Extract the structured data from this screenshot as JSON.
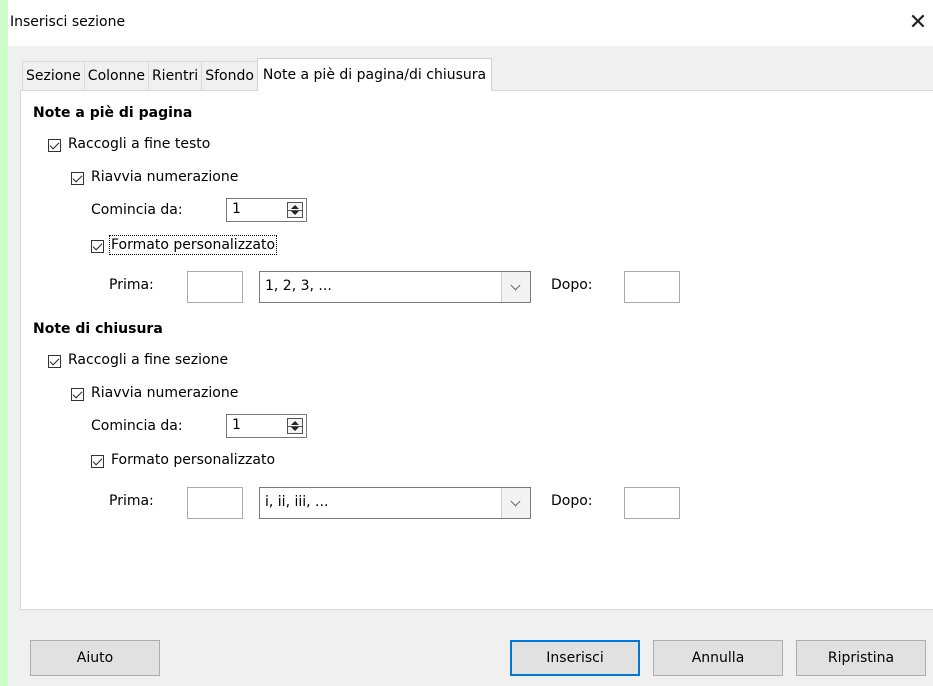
{
  "dialog": {
    "title": "Inserisci sezione",
    "close_glyph": "✕"
  },
  "tabs": [
    {
      "label": "Sezione",
      "active": false
    },
    {
      "label": "Colonne",
      "active": false
    },
    {
      "label": "Rientri",
      "active": false
    },
    {
      "label": "Sfondo",
      "active": false
    },
    {
      "label": "Note a piè di pagina/di chiusura",
      "active": true
    }
  ],
  "footnotes": {
    "heading": "Note a piè di pagina",
    "collect": {
      "label": "Raccogli a fine testo",
      "checked": true
    },
    "restart": {
      "label": "Riavvia numerazione",
      "checked": true
    },
    "start_label": "Comincia da:",
    "start_value": "1",
    "custom_format": {
      "label": "Formato personalizzato",
      "checked": true
    },
    "before_label": "Prima:",
    "before_value": "",
    "format_value": "1, 2, 3, ...",
    "after_label": "Dopo:",
    "after_value": ""
  },
  "endnotes": {
    "heading": "Note di chiusura",
    "collect": {
      "label": "Raccogli a fine sezione",
      "checked": true
    },
    "restart": {
      "label": "Riavvia numerazione",
      "checked": true
    },
    "start_label": "Comincia da:",
    "start_value": "1",
    "custom_format": {
      "label": "Formato personalizzato",
      "checked": true
    },
    "before_label": "Prima:",
    "before_value": "",
    "format_value": "i, ii, iii, ...",
    "after_label": "Dopo:",
    "after_value": ""
  },
  "buttons": {
    "help": "Aiuto",
    "insert": "Inserisci",
    "cancel": "Annulla",
    "reset": "Ripristina"
  },
  "icons": {
    "close": "close-icon",
    "spin": "spin-arrows-icon",
    "dropdown": "chevron-down-icon",
    "check": "checkmark-icon"
  }
}
